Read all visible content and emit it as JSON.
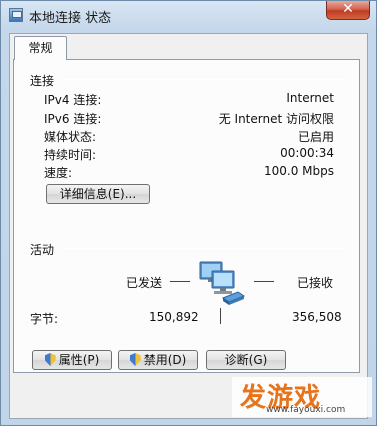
{
  "window": {
    "title": "本地连接 状态",
    "close_glyph": "✕"
  },
  "tabs": [
    {
      "label": "常规"
    }
  ],
  "connection": {
    "group_label": "连接",
    "rows": [
      {
        "label": "IPv4 连接:",
        "value": "Internet"
      },
      {
        "label": "IPv6 连接:",
        "value": "无 Internet 访问权限"
      },
      {
        "label": "媒体状态:",
        "value": "已启用"
      },
      {
        "label": "持续时间:",
        "value": "00:00:34"
      },
      {
        "label": "速度:",
        "value": "100.0 Mbps"
      }
    ],
    "details_button": "详细信息(E)..."
  },
  "activity": {
    "group_label": "活动",
    "sent_label": "已发送",
    "received_label": "已接收",
    "bytes_label": "字节:",
    "bytes_sent": "150,892",
    "bytes_received": "356,508",
    "icon": "network-computers-icon"
  },
  "buttons": {
    "properties": "属性(P)",
    "disable": "禁用(D)",
    "diagnose": "诊断(G)"
  },
  "watermark": {
    "main": "发游戏",
    "sub": "www.fayouxi.com"
  }
}
